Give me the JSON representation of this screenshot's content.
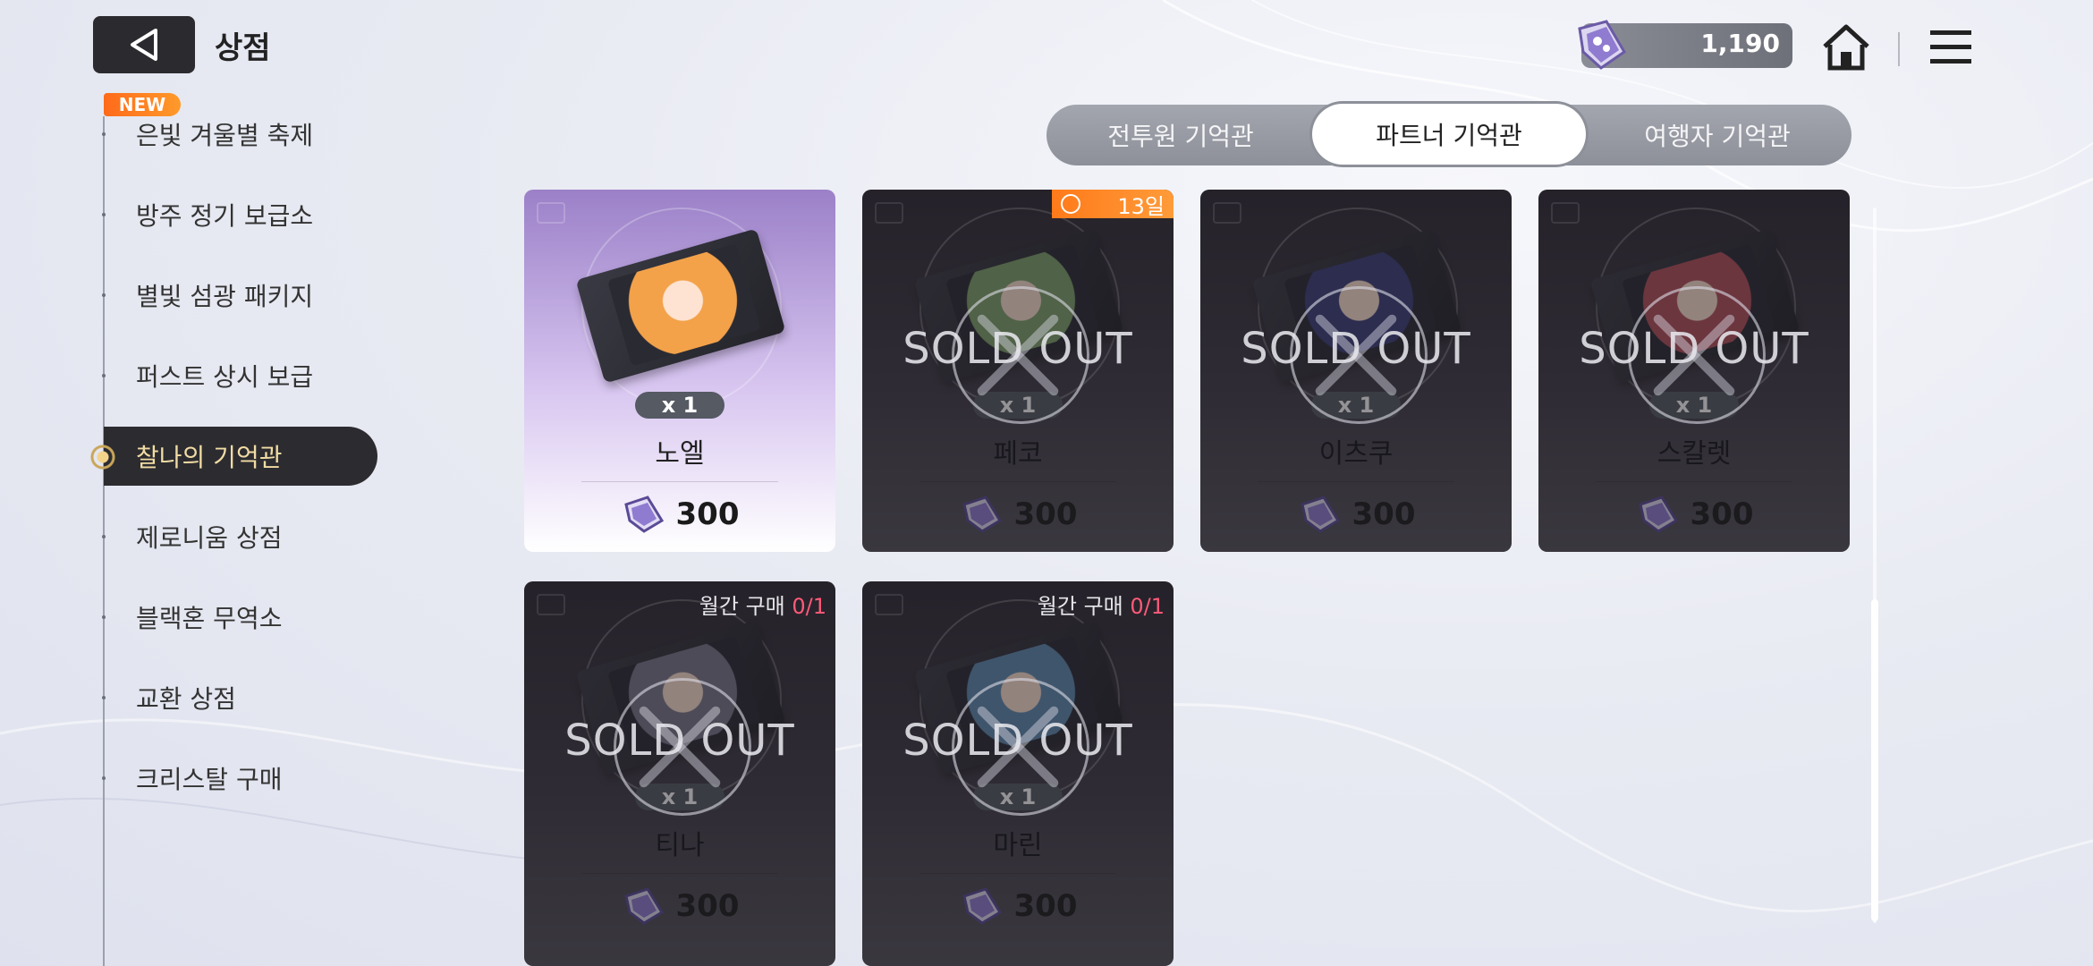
{
  "header": {
    "title": "상점",
    "currency_value": "1,190"
  },
  "sidebar": {
    "new_badge": "NEW",
    "items": [
      {
        "label": "은빛 겨울별 축제"
      },
      {
        "label": "방주 정기 보급소"
      },
      {
        "label": "별빛 섬광 패키지"
      },
      {
        "label": "퍼스트 상시 보급"
      },
      {
        "label": "찰나의 기억관",
        "active": true
      },
      {
        "label": "제로니움 상점"
      },
      {
        "label": "블랙혼 무역소"
      },
      {
        "label": "교환 상점"
      },
      {
        "label": "크리스탈 구매"
      }
    ]
  },
  "tabs": [
    {
      "label": "전투원 기억관"
    },
    {
      "label": "파트너 기억관",
      "active": true
    },
    {
      "label": "여행자 기억관"
    }
  ],
  "cards": [
    {
      "name": "노엘",
      "qty": "x 1",
      "price": "300",
      "status": "available",
      "face_color": "#f3a24a"
    },
    {
      "name": "페코",
      "qty": "x 1",
      "price": "300",
      "status": "SOLD OUT",
      "timer": "13일",
      "face_color": "#7fa36a"
    },
    {
      "name": "이츠쿠",
      "qty": "x 1",
      "price": "300",
      "status": "SOLD OUT",
      "face_color": "#3a3f7a"
    },
    {
      "name": "스칼렛",
      "qty": "x 1",
      "price": "300",
      "status": "SOLD OUT",
      "face_color": "#b5505a"
    },
    {
      "name": "티나",
      "qty": "x 1",
      "price": "300",
      "status": "SOLD OUT",
      "limit_label": "월간 구매",
      "limit_count": "0/1",
      "face_color": "#7a7888"
    },
    {
      "name": "마린",
      "qty": "x 1",
      "price": "300",
      "status": "SOLD OUT",
      "limit_label": "월간 구매",
      "limit_count": "0/1",
      "face_color": "#5f8bb0"
    }
  ],
  "colors": {
    "accent_orange": "#ff8a24",
    "limit_red": "#ff5a78",
    "active_text": "#f1dca4"
  },
  "icons": {
    "back": "back-triangle-icon",
    "currency": "crystal-gem-icon",
    "home": "home-icon",
    "menu": "hamburger-menu-icon"
  }
}
